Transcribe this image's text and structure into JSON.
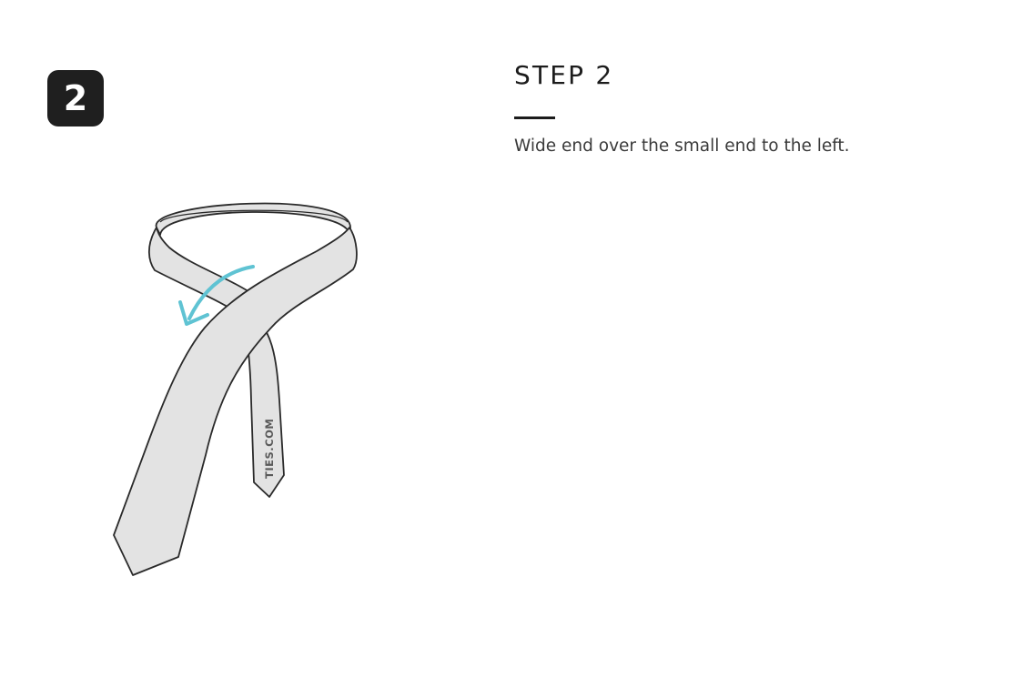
{
  "badge": {
    "number": "2"
  },
  "illustration": {
    "watermark": "TIES.COM",
    "arrow_icon": "curved-arrow-left-icon",
    "colors": {
      "tie_fill": "#e3e3e3",
      "outline": "#2a2a2a",
      "arrow": "#5fc3d3"
    }
  },
  "content": {
    "title": "STEP 2",
    "description": "Wide end over the small end to the left."
  }
}
